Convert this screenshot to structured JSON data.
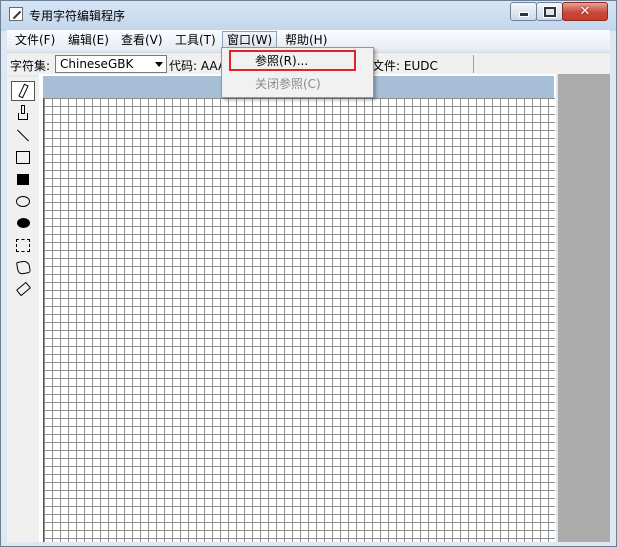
{
  "window": {
    "title": "专用字符编辑程序",
    "icon": "pencil-document-icon"
  },
  "title_controls": {
    "minimize_icon": "minimize-icon",
    "maximize_icon": "maximize-icon",
    "close_label": "✕"
  },
  "menubar": {
    "items": [
      {
        "label": "文件(F)"
      },
      {
        "label": "编辑(E)"
      },
      {
        "label": "查看(V)"
      },
      {
        "label": "工具(T)"
      },
      {
        "label": "窗口(W)"
      },
      {
        "label": "帮助(H)"
      }
    ]
  },
  "toolbar": {
    "charset_label": "字符集:",
    "charset_value": "ChineseGBK",
    "code_label": "代码: AAA",
    "file_label": "文件: EUDC"
  },
  "tools": [
    {
      "icon": "pencil-icon",
      "selected": true
    },
    {
      "icon": "brush-icon"
    },
    {
      "icon": "line-icon"
    },
    {
      "icon": "hollow-rectangle-icon"
    },
    {
      "icon": "filled-rectangle-icon"
    },
    {
      "icon": "hollow-ellipse-icon"
    },
    {
      "icon": "filled-ellipse-icon"
    },
    {
      "icon": "rectangular-selection-icon"
    },
    {
      "icon": "freeform-selection-icon"
    },
    {
      "icon": "eraser-icon"
    }
  ],
  "window_menu": {
    "items": [
      {
        "label": "参照(R)...",
        "enabled": true
      },
      {
        "label": "关闭参照(C)",
        "enabled": false
      }
    ]
  },
  "colors": {
    "highlight": "#e2232a",
    "grid_header": "#a7bfd6"
  }
}
